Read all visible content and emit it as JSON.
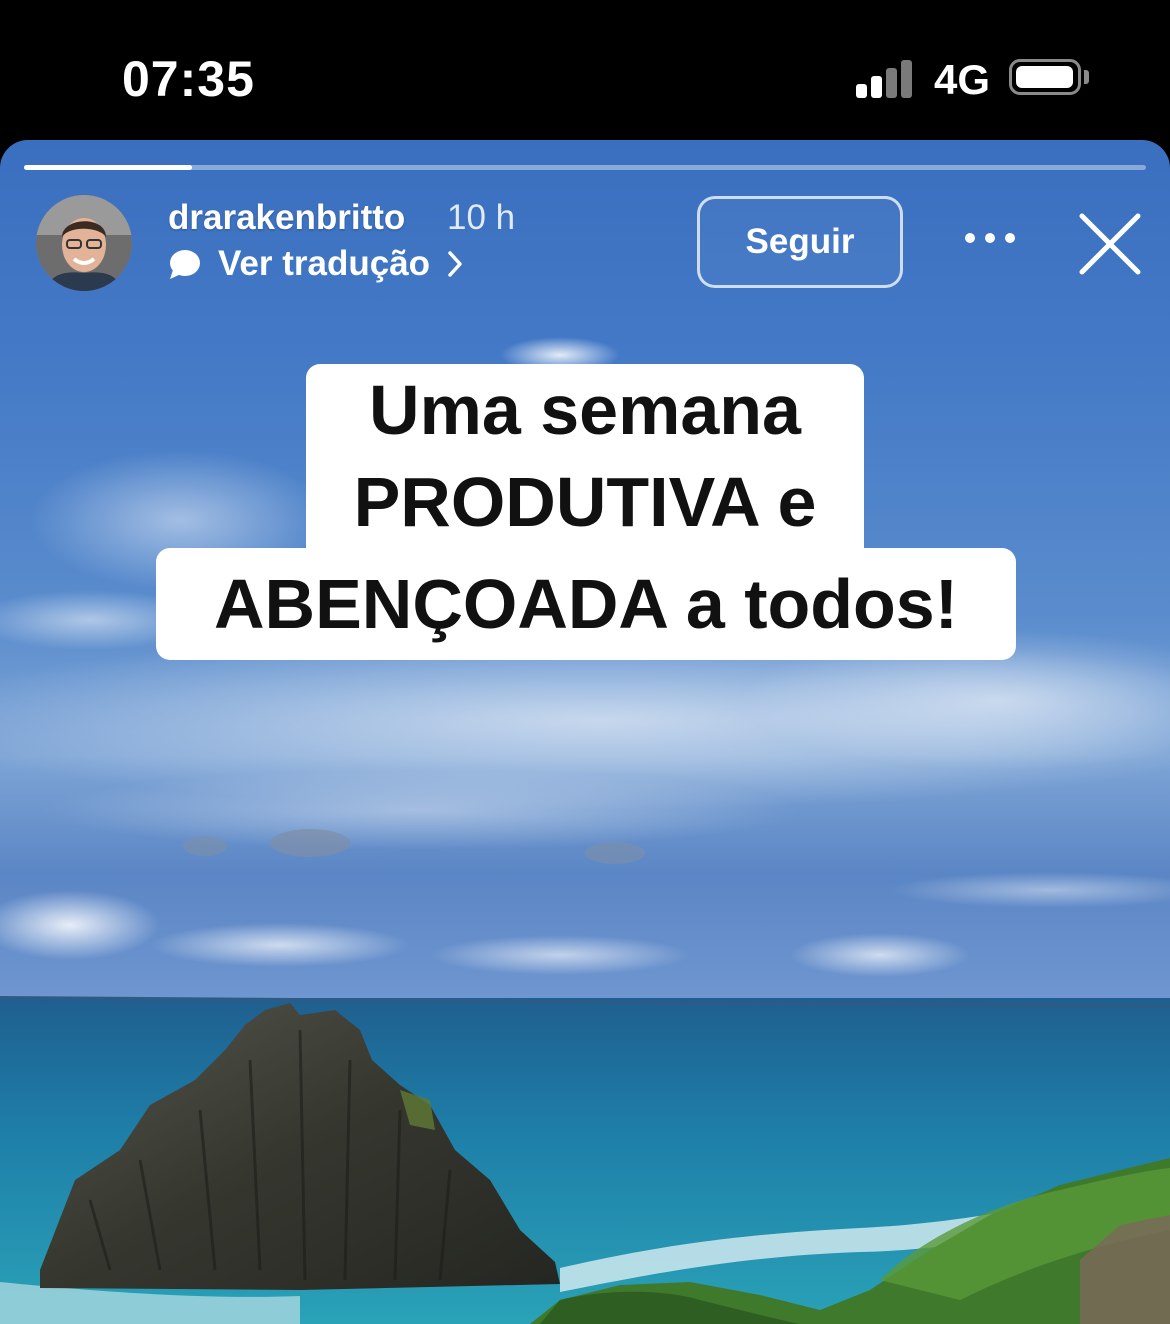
{
  "status_bar": {
    "time": "07:35",
    "network": "4G"
  },
  "story": {
    "progress_fraction": 0.15,
    "username": "drarakenbritto",
    "time_ago": "10 h",
    "translate_label": "Ver tradução",
    "follow_label": "Seguir",
    "caption": {
      "line1": "Uma semana",
      "line2": "PRODUTIVA e",
      "line3": "ABENÇOADA a todos!"
    }
  },
  "colors": {
    "sky": "#4379c6",
    "ocean": "#1d7fa6",
    "rock": "#3b3d3a",
    "vegetation": "#3f7a2c"
  },
  "icons": [
    "signal-icon",
    "battery-icon",
    "chat-bubble-icon",
    "chevron-right-icon",
    "more-icon",
    "close-icon"
  ]
}
